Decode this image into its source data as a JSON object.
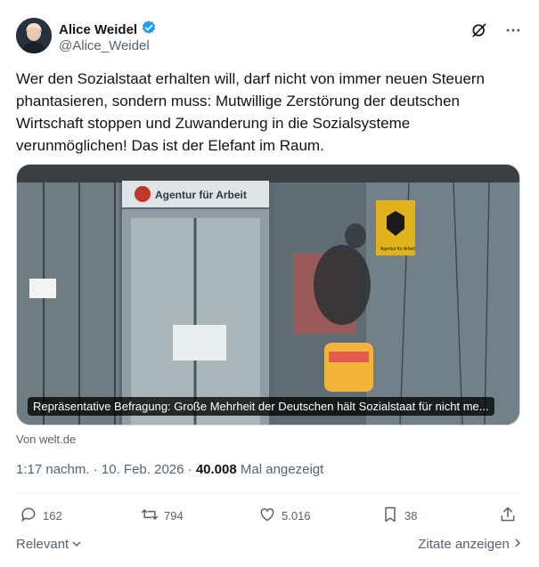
{
  "author": {
    "name": "Alice Weidel",
    "handle": "@Alice_Weidel"
  },
  "tweet": {
    "text": "Wer den Sozialstaat erhalten will, darf nicht von immer neuen Steuern phantasieren, sondern muss: Mutwillige Zerstörung der deutschen Wirtschaft stoppen und Zuwanderung in die Sozialsysteme verunmöglichen! Das ist der Elefant im Raum."
  },
  "media": {
    "sign_text": "Agentur für Arbeit",
    "emblem_text": "Agentur für Arbeit",
    "caption": "Repräsentative Befragung: Große Mehrheit der Deutschen hält Sozialstaat für nicht me...",
    "source": "Von welt.de"
  },
  "meta": {
    "time": "1:17 nachm.",
    "date": "10. Feb. 2026",
    "views_count": "40.008",
    "views_label": "Mal angezeigt"
  },
  "actions": {
    "replies": "162",
    "reposts": "794",
    "likes": "5.016",
    "bookmarks": "38"
  },
  "footer": {
    "sort_label": "Relevant",
    "quotes_label": "Zitate anzeigen"
  },
  "colors": {
    "verified": "#1d9bf0",
    "muted": "#536471",
    "text": "#0f1419"
  }
}
